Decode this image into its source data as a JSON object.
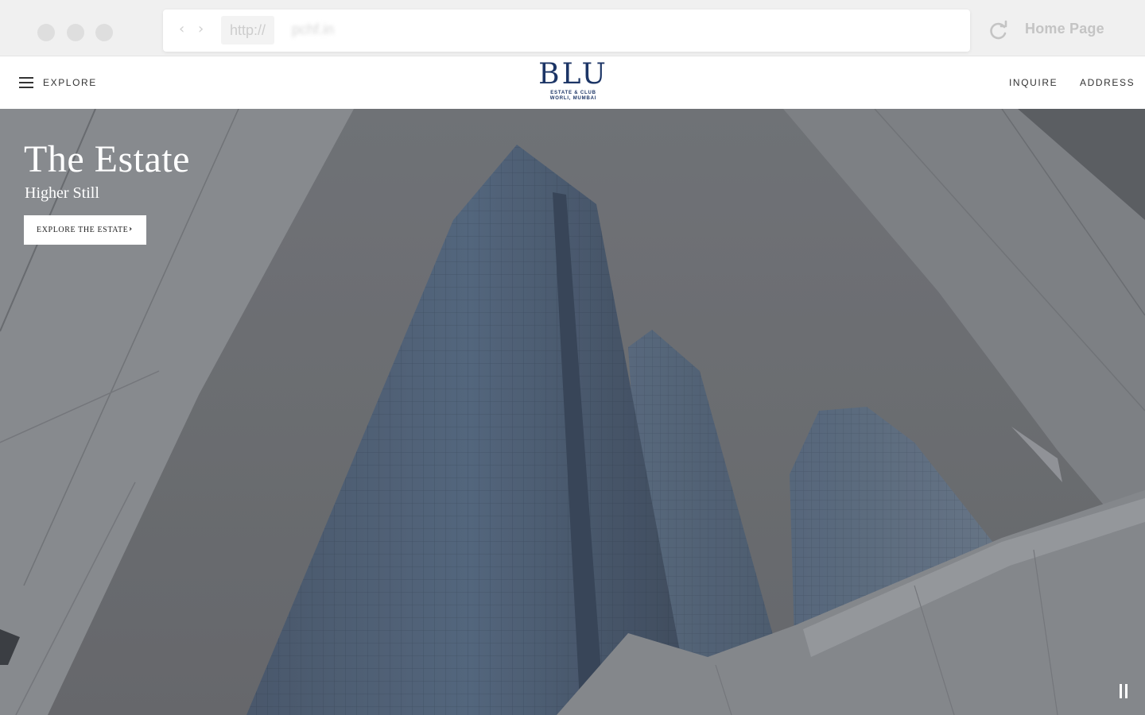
{
  "browser": {
    "protocol": "http://",
    "domain": "pchf.in",
    "home_label": "Home Page",
    "icons": {
      "back": "chevron-left-icon",
      "forward": "chevron-right-icon",
      "reload": "reload-icon"
    }
  },
  "header": {
    "menu_label": "EXPLORE",
    "logo": {
      "wordmark": "BLU",
      "line1": "ESTATE & CLUB",
      "line2": "WORLI, MUMBAI"
    },
    "links": [
      "INQUIRE",
      "ADDRESS"
    ]
  },
  "hero": {
    "title": "The Estate",
    "subtitle": "Higher Still",
    "cta_label": "EXPLORE THE ESTATE",
    "cta_icon": "chevron-right-icon",
    "control_icon": "pause-icon"
  },
  "colors": {
    "brand": "#1c3566",
    "hero_overlay": "#6f7276",
    "text_dark": "#333333",
    "white": "#ffffff"
  }
}
